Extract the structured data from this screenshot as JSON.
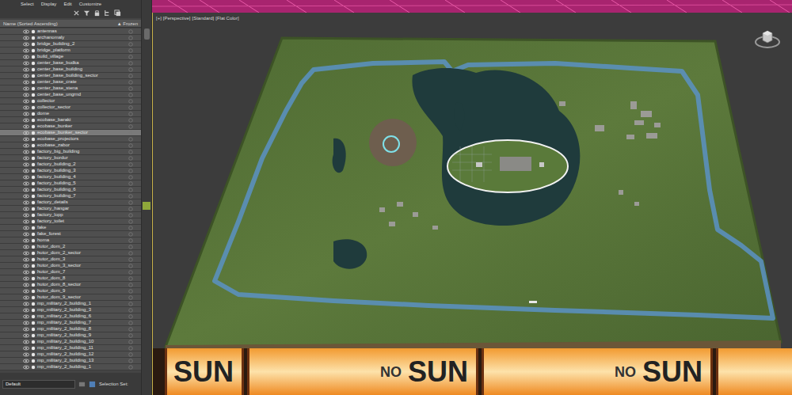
{
  "window": {
    "menu": [
      "Select",
      "Display",
      "Edit",
      "Customize"
    ]
  },
  "explorer": {
    "columns": {
      "name": "Name (Sorted Ascending)",
      "frozen": "▲ Frozen"
    },
    "rows": [
      {
        "name": "antennas",
        "selected": false
      },
      {
        "name": "archanomaly",
        "selected": false
      },
      {
        "name": "bridge_building_2",
        "selected": false
      },
      {
        "name": "bridge_platform",
        "selected": false
      },
      {
        "name": "build_village",
        "selected": false
      },
      {
        "name": "center_base_budka",
        "selected": false
      },
      {
        "name": "center_base_building",
        "selected": false
      },
      {
        "name": "center_base_building_sector",
        "selected": false
      },
      {
        "name": "center_base_crate",
        "selected": false
      },
      {
        "name": "center_base_stena",
        "selected": false
      },
      {
        "name": "center_base_ungrnd",
        "selected": false
      },
      {
        "name": "collector",
        "selected": false
      },
      {
        "name": "collector_sector",
        "selected": false
      },
      {
        "name": "dome",
        "selected": false
      },
      {
        "name": "ecobase_baraki",
        "selected": false
      },
      {
        "name": "ecobase_bunker",
        "selected": false
      },
      {
        "name": "ecobase_bunker_sector",
        "selected": true
      },
      {
        "name": "ecobase_projectors",
        "selected": false
      },
      {
        "name": "ecobase_zabor",
        "selected": false
      },
      {
        "name": "factory_big_building",
        "selected": false
      },
      {
        "name": "factory_bordur",
        "selected": false
      },
      {
        "name": "factory_building_2",
        "selected": false
      },
      {
        "name": "factory_building_3",
        "selected": false
      },
      {
        "name": "factory_building_4",
        "selected": false
      },
      {
        "name": "factory_building_5",
        "selected": false
      },
      {
        "name": "factory_building_6",
        "selected": false
      },
      {
        "name": "factory_building_7",
        "selected": false
      },
      {
        "name": "factory_details",
        "selected": false
      },
      {
        "name": "factory_hangar",
        "selected": false
      },
      {
        "name": "factory_lopp",
        "selected": false
      },
      {
        "name": "factory_toilet",
        "selected": false
      },
      {
        "name": "fake",
        "selected": false
      },
      {
        "name": "fake_forest",
        "selected": false
      },
      {
        "name": "homa",
        "selected": false
      },
      {
        "name": "hutor_dom_2",
        "selected": false
      },
      {
        "name": "hutor_dom_2_sector",
        "selected": false
      },
      {
        "name": "hutor_dom_3",
        "selected": false
      },
      {
        "name": "hutor_dom_3_sector",
        "selected": false
      },
      {
        "name": "hutor_dom_7",
        "selected": false
      },
      {
        "name": "hutor_dom_8",
        "selected": false
      },
      {
        "name": "hutor_dom_8_sector",
        "selected": false
      },
      {
        "name": "hutor_dom_9",
        "selected": false
      },
      {
        "name": "hutor_dom_9_sector",
        "selected": false
      },
      {
        "name": "mp_military_2_building_1",
        "selected": false
      },
      {
        "name": "mp_military_2_building_3",
        "selected": false
      },
      {
        "name": "mp_military_2_building_6",
        "selected": false
      },
      {
        "name": "mp_military_2_building_7",
        "selected": false
      },
      {
        "name": "mp_military_2_building_8",
        "selected": false
      },
      {
        "name": "mp_military_2_building_9",
        "selected": false
      },
      {
        "name": "mp_military_2_building_10",
        "selected": false
      },
      {
        "name": "mp_military_2_building_11",
        "selected": false
      },
      {
        "name": "mp_military_2_building_12",
        "selected": false
      },
      {
        "name": "mp_military_2_building_13",
        "selected": false
      },
      {
        "name": "mp_military_2_building_1",
        "selected": false
      }
    ]
  },
  "bottom_bar": {
    "layer": "Default",
    "selection_set": "Selection Set:"
  },
  "viewport": {
    "labels": [
      "[+]",
      "[Perspective]",
      "[Standard]",
      "[Flat Color]"
    ],
    "banners": [
      {
        "prefix": "",
        "word": "SUN"
      },
      {
        "prefix": "NO",
        "word": "SUN"
      },
      {
        "prefix": "NO",
        "word": "SUN"
      }
    ]
  }
}
